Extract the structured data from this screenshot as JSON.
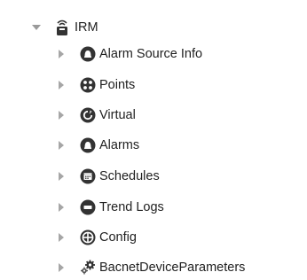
{
  "tree": {
    "root": {
      "label": "IRM",
      "expanded": true,
      "icon": "station-icon"
    },
    "children": [
      {
        "label": "Alarm Source Info",
        "icon": "alarm-source-info-icon",
        "expanded": false
      },
      {
        "label": "Points",
        "icon": "points-icon",
        "expanded": false
      },
      {
        "label": "Virtual",
        "icon": "virtual-icon",
        "expanded": false
      },
      {
        "label": "Alarms",
        "icon": "alarms-icon",
        "expanded": false
      },
      {
        "label": "Schedules",
        "icon": "schedules-icon",
        "expanded": false
      },
      {
        "label": "Trend Logs",
        "icon": "trend-logs-icon",
        "expanded": false
      },
      {
        "label": "Config",
        "icon": "config-icon",
        "expanded": false
      },
      {
        "label": "BacnetDeviceParameters",
        "icon": "gears-icon",
        "expanded": false
      }
    ]
  },
  "colors": {
    "icon_dark": "#333333",
    "caret": "#a6a6a6",
    "text": "#1f1f1f"
  }
}
